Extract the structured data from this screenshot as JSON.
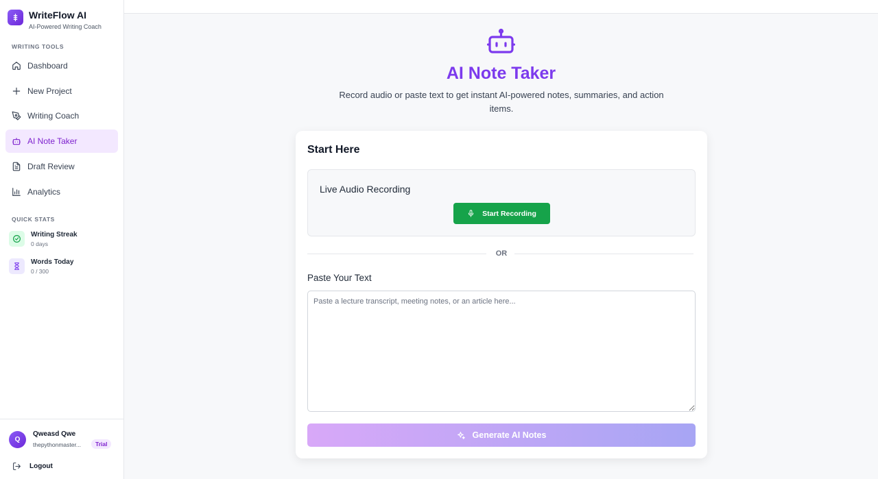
{
  "brand": {
    "title": "WriteFlow AI",
    "subtitle": "AI-Powered Writing Coach",
    "logo_icon": "text-cursor-icon"
  },
  "sidebar": {
    "tools_label": "WRITING TOOLS",
    "items": [
      {
        "label": "Dashboard",
        "icon": "home-icon"
      },
      {
        "label": "New Project",
        "icon": "plus-icon"
      },
      {
        "label": "Writing Coach",
        "icon": "pen-tool-icon"
      },
      {
        "label": "AI Note Taker",
        "icon": "bot-icon",
        "active": true
      },
      {
        "label": "Draft Review",
        "icon": "file-text-icon"
      },
      {
        "label": "Analytics",
        "icon": "bar-chart-icon"
      }
    ],
    "stats_label": "QUICK STATS",
    "stats": [
      {
        "title": "Writing Streak",
        "value": "0 days",
        "icon": "check-circle-icon"
      },
      {
        "title": "Words Today",
        "value": "0 / 300",
        "icon": "hourglass-icon"
      }
    ]
  },
  "user": {
    "initial": "Q",
    "name": "Qweasd Qwe",
    "email": "thepythonmaster...",
    "badge": "Trial",
    "logout_label": "Logout"
  },
  "hero": {
    "title": "AI Note Taker",
    "description": "Record audio or paste text to get instant AI-powered notes, summaries, and action items."
  },
  "card": {
    "title": "Start Here",
    "audio_title": "Live Audio Recording",
    "record_button": "Start Recording",
    "or_label": "OR",
    "paste_label": "Paste Your Text",
    "paste_value": "",
    "paste_placeholder": "Paste a lecture transcript, meeting notes, or an article here...",
    "generate_button": "Generate AI Notes"
  },
  "colors": {
    "accent": "#7c3aed",
    "record_green": "#16a34a",
    "active_bg": "#f3e8ff"
  }
}
